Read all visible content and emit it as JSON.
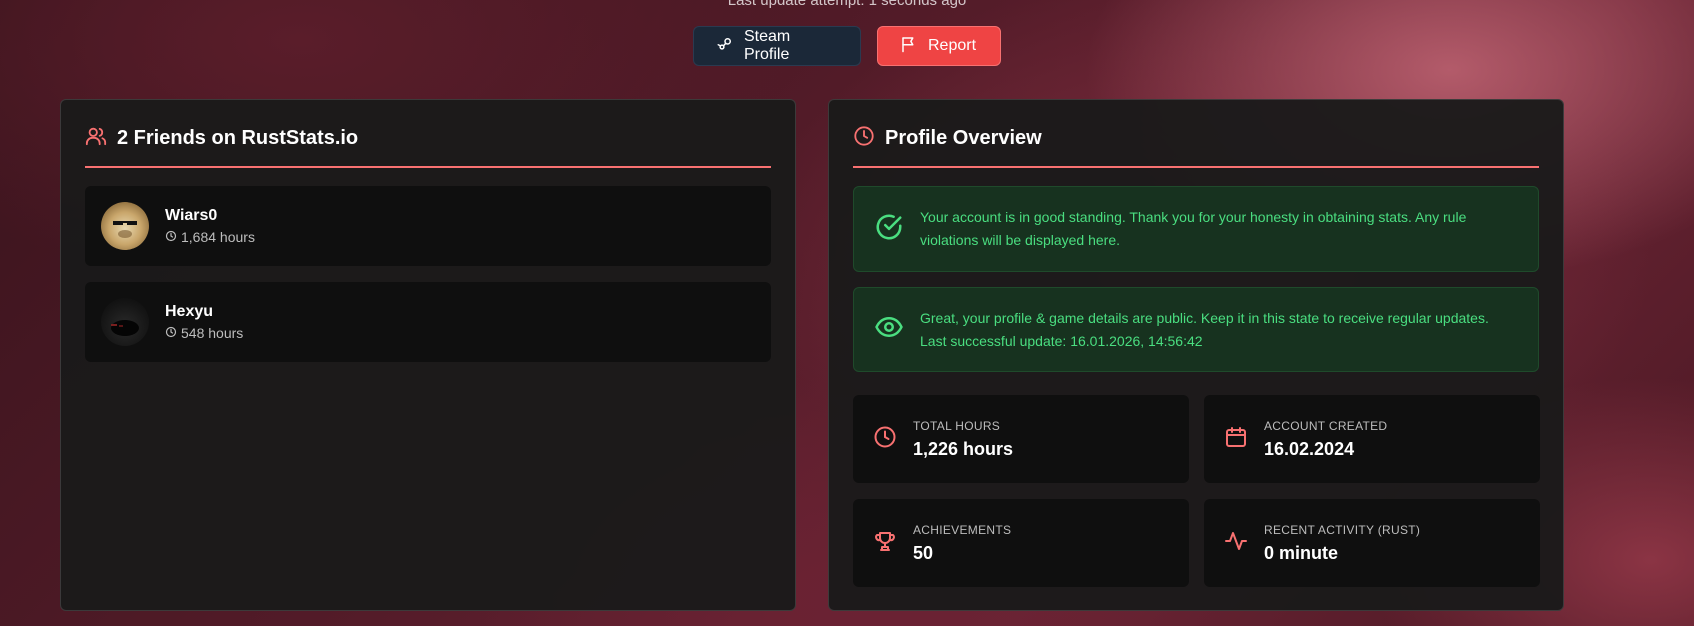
{
  "header": {
    "last_update": "Last update attempt: 1 seconds ago",
    "steam_button": "Steam Profile",
    "report_button": "Report"
  },
  "friends": {
    "title": "2 Friends on RustStats.io",
    "items": [
      {
        "name": "Wiars0",
        "hours": "1,684 hours"
      },
      {
        "name": "Hexyu",
        "hours": "548 hours"
      }
    ]
  },
  "overview": {
    "title": "Profile Overview",
    "standing_text": "Your account is in good standing. Thank you for your honesty in obtaining stats. Any rule violations will be displayed here.",
    "public_line1": "Great, your profile & game details are public. Keep it in this state to receive regular updates.",
    "public_line2": "Last successful update: 16.01.2026, 14:56:42",
    "stats": [
      {
        "label": "TOTAL HOURS",
        "value": "1,226 hours",
        "icon": "clock-icon"
      },
      {
        "label": "ACCOUNT CREATED",
        "value": "16.02.2024",
        "icon": "calendar-icon"
      },
      {
        "label": "ACHIEVEMENTS",
        "value": "50",
        "icon": "trophy-icon"
      },
      {
        "label": "RECENT ACTIVITY (RUST)",
        "value": "0 minute",
        "icon": "activity-icon"
      }
    ]
  },
  "colors": {
    "accent": "#f87171",
    "success": "#4ade80",
    "report": "#ef4444",
    "steam": "#1b2838"
  }
}
